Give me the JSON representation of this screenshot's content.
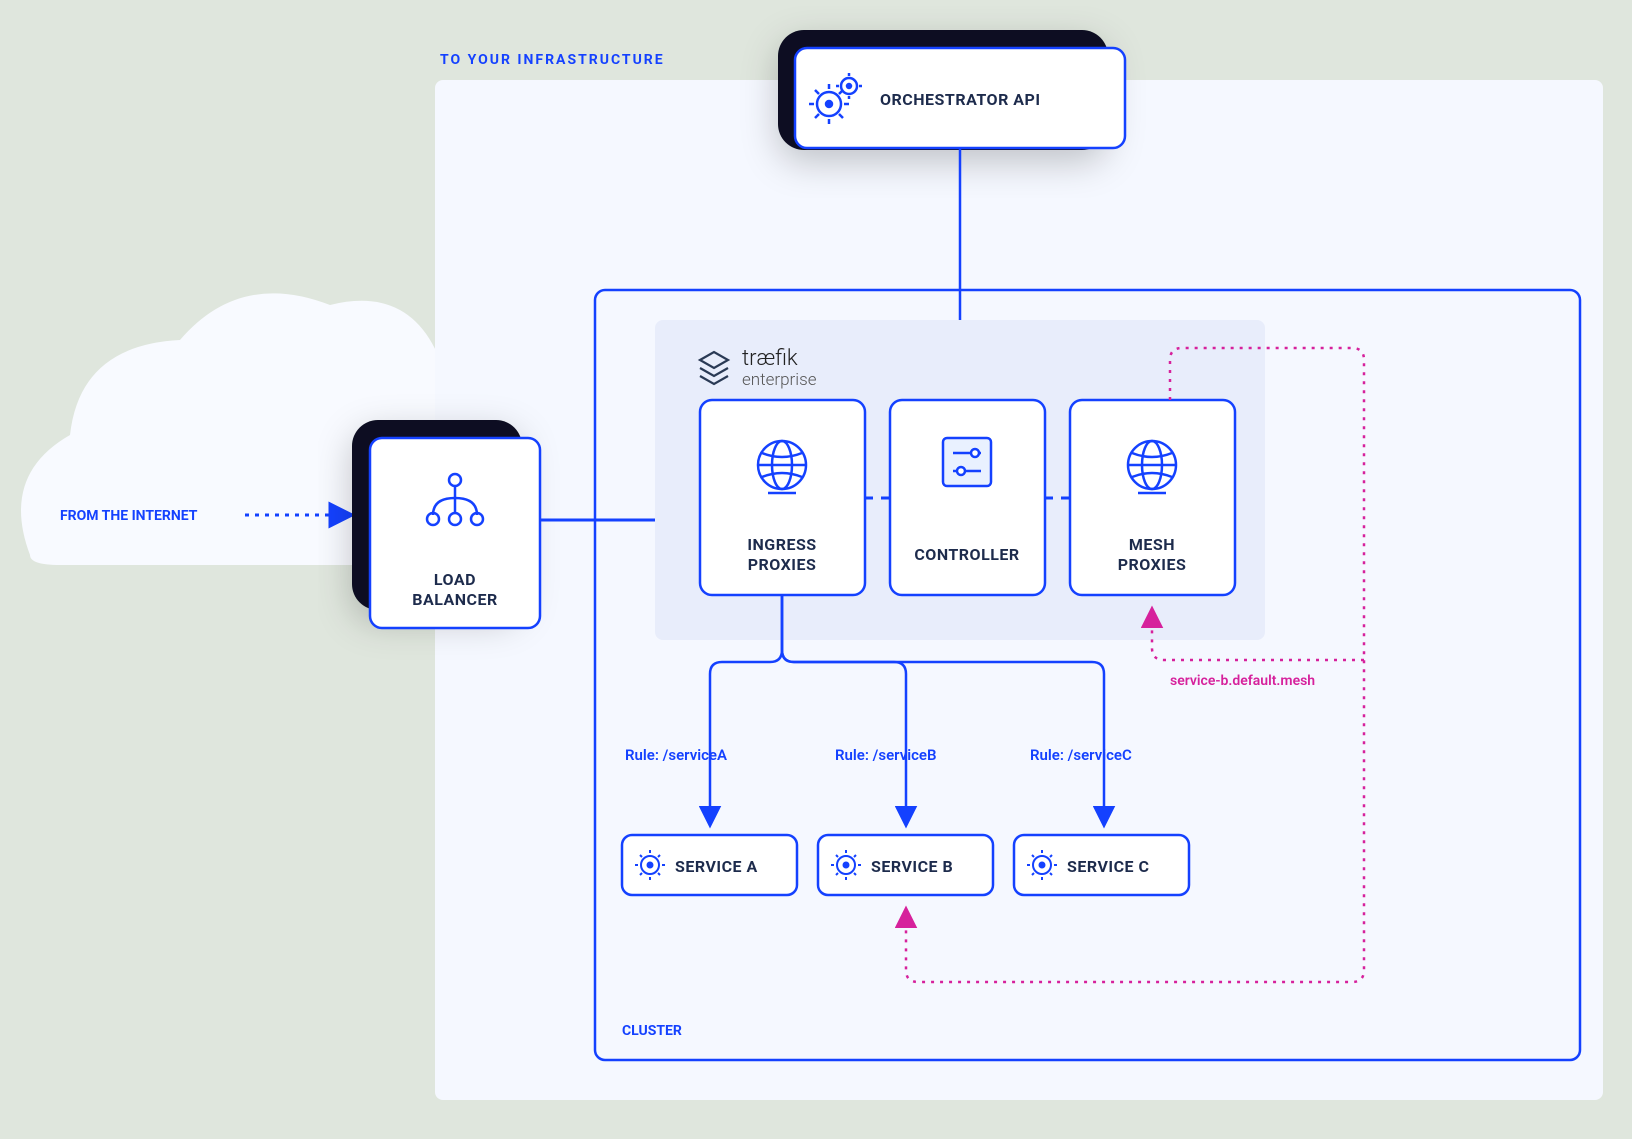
{
  "labels": {
    "fromInternet": "FROM THE INTERNET",
    "toInfra": "TO YOUR INFRASTRUCTURE",
    "orchestrator": "ORCHESTRATOR API",
    "loadBalancer1": "LOAD",
    "loadBalancer2": "BALANCER",
    "ingress1": "INGRESS",
    "ingress2": "PROXIES",
    "controller": "CONTROLLER",
    "mesh1": "MESH",
    "mesh2": "PROXIES",
    "cluster": "CLUSTER",
    "brand1": "træfik",
    "brand2": "enterprise",
    "ruleA": "Rule: /serviceA",
    "ruleB": "Rule: /serviceB",
    "ruleC": "Rule: /serviceC",
    "serviceA": "SERVICE A",
    "serviceB": "SERVICE B",
    "serviceC": "SERVICE C",
    "meshRoute": "service-b.default.mesh"
  },
  "colors": {
    "blue": "#1441ff",
    "panel": "#f6f8ff",
    "innerPanel": "#e9eeff",
    "boxFill": "#ffffff",
    "dark": "#1d2b4c",
    "magenta": "#d6219c",
    "shadow": "#0a1020"
  }
}
